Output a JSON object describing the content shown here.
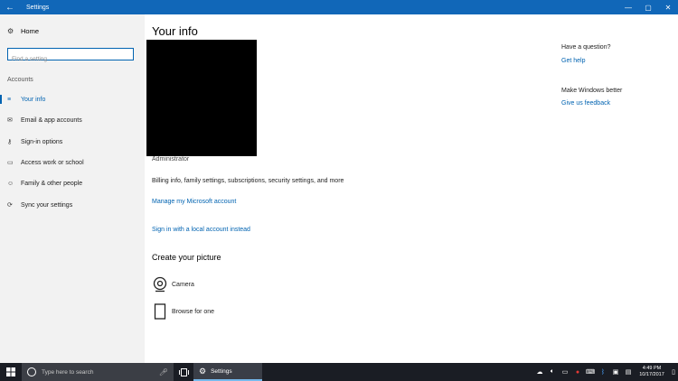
{
  "window": {
    "title": "Settings",
    "back_glyph": "←",
    "min_glyph": "—",
    "max_glyph": "▢",
    "close_glyph": "✕"
  },
  "sidebar": {
    "home_label": "Home",
    "search_placeholder": "Find a setting",
    "section": "Accounts",
    "items": [
      {
        "label": "Your info",
        "icon": "person-list-icon",
        "glyph": "≡",
        "active": true
      },
      {
        "label": "Email & app accounts",
        "icon": "mail-icon",
        "glyph": "✉",
        "active": false
      },
      {
        "label": "Sign-in options",
        "icon": "key-icon",
        "glyph": "⚷",
        "active": false
      },
      {
        "label": "Access work or school",
        "icon": "briefcase-icon",
        "glyph": "▭",
        "active": false
      },
      {
        "label": "Family & other people",
        "icon": "people-icon",
        "glyph": "☺",
        "active": false
      },
      {
        "label": "Sync your settings",
        "icon": "sync-icon",
        "glyph": "⟳",
        "active": false
      }
    ]
  },
  "main": {
    "title": "Your info",
    "role": "Administrator",
    "billing_text": "Billing info, family settings, subscriptions, security settings, and more",
    "manage_link": "Manage my Microsoft account",
    "local_link": "Sign in with a local account instead",
    "picture_heading": "Create your picture",
    "camera_label": "Camera",
    "browse_label": "Browse for one"
  },
  "right": {
    "question_heading": "Have a question?",
    "help_link": "Get help",
    "better_heading": "Make Windows better",
    "feedback_link": "Give us feedback"
  },
  "taskbar": {
    "search_placeholder": "Type here to search",
    "app_label": "Settings",
    "time": "4:49 PM",
    "date": "10/17/2017"
  },
  "colors": {
    "accent": "#0063b1",
    "titlebar": "#1167b8",
    "sidebar_bg": "#f2f2f2",
    "taskbar_bg": "#1a1d24"
  }
}
